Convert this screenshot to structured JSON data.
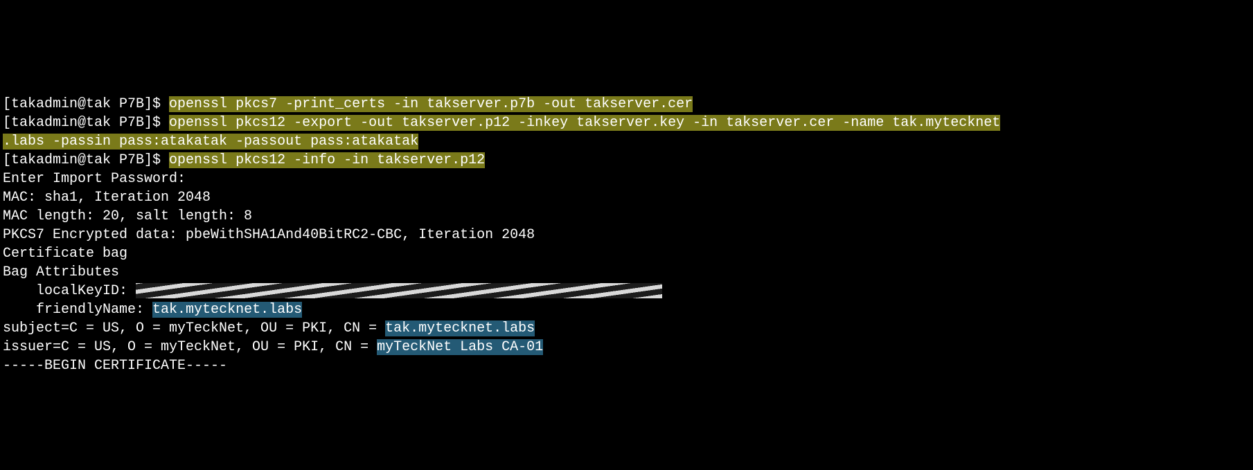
{
  "prompt": "[takadmin@tak P7B]$ ",
  "cmd1": "openssl pkcs7 -print_certs -in takserver.p7b -out takserver.cer",
  "cmd2a": "openssl pkcs12 -export -out takserver.p12 -inkey takserver.key -in takserver.cer -name tak.mytecknet",
  "cmd2b": ".labs -passin pass:atakatak -passout pass:atakatak",
  "cmd3": "openssl pkcs12 -info -in takserver.p12",
  "out": {
    "enter_pw": "Enter Import Password:",
    "mac1": "MAC: sha1, Iteration 2048",
    "mac2": "MAC length: 20, salt length: 8",
    "pkcs7": "PKCS7 Encrypted data: pbeWithSHA1And40BitRC2-CBC, Iteration 2048",
    "certbag": "Certificate bag",
    "bagattr": "Bag Attributes",
    "localkey_label": "    localKeyID: ",
    "friendly_label": "    friendlyName: ",
    "friendly_value": "tak.mytecknet.labs",
    "subject_pre": "subject=C = US, O = myTeckNet, OU = PKI, CN = ",
    "subject_cn": "tak.mytecknet.labs",
    "blank": "",
    "issuer_pre": "issuer=C = US, O = myTeckNet, OU = PKI, CN = ",
    "issuer_cn": "myTeckNet Labs CA-01",
    "begin_cert": "-----BEGIN CERTIFICATE-----"
  }
}
